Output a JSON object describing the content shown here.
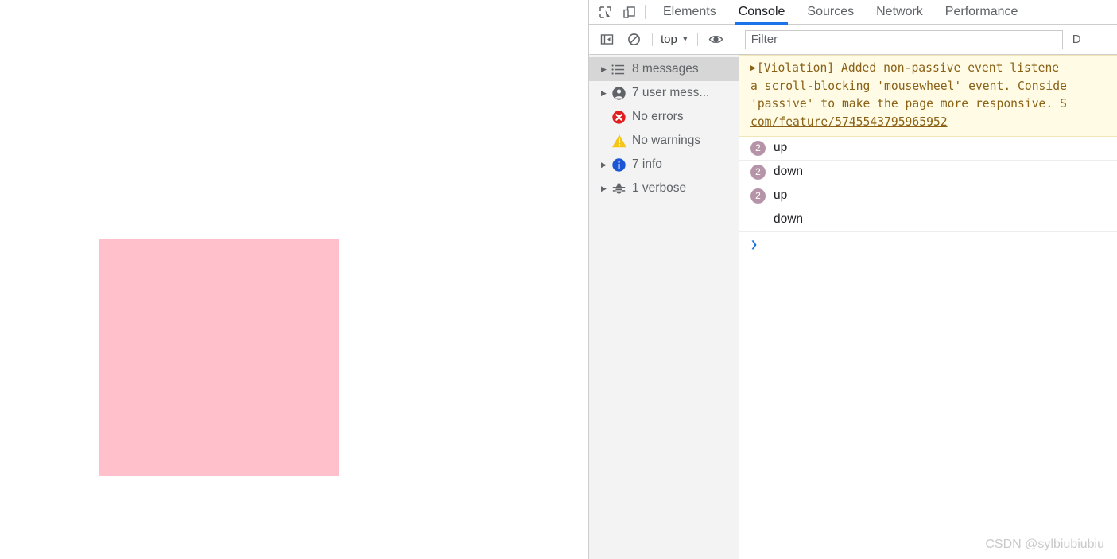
{
  "page": {
    "pink_box": {
      "color": "#ffc0cb"
    }
  },
  "devtools": {
    "toolbar_icons": [
      {
        "name": "inspect-element-icon"
      },
      {
        "name": "device-toolbar-icon"
      }
    ],
    "tabs": [
      {
        "label": "Elements",
        "active": false
      },
      {
        "label": "Console",
        "active": true
      },
      {
        "label": "Sources",
        "active": false
      },
      {
        "label": "Network",
        "active": false
      },
      {
        "label": "Performance",
        "active": false
      }
    ],
    "accent_color": "#1a73e8",
    "filterbar": {
      "sidebar_toggle_icon": "sidebar-toggle-icon",
      "clear_console_icon": "clear-console-icon",
      "context_selector": "top",
      "context_caret": "▼",
      "live_expression_icon": "eye-icon",
      "filter_placeholder": "Filter",
      "filter_value": "",
      "levels_label": "D"
    },
    "sidebar": {
      "rows": [
        {
          "arrow": "▶",
          "icon": "list-icon",
          "label": "8 messages",
          "selected": true
        },
        {
          "arrow": "▶",
          "icon": "user-icon",
          "label": "7 user mess...",
          "selected": false
        },
        {
          "arrow": "",
          "icon": "error-icon",
          "label": "No errors",
          "selected": false
        },
        {
          "arrow": "",
          "icon": "warning-icon",
          "label": "No warnings",
          "selected": false
        },
        {
          "arrow": "▶",
          "icon": "info-icon",
          "label": "7 info",
          "selected": false
        },
        {
          "arrow": "▶",
          "icon": "verbose-bug-icon",
          "label": "1 verbose",
          "selected": false
        }
      ]
    },
    "console": {
      "violation": {
        "expand_arrow": "▶",
        "line1": "[Violation] Added non-passive event listene",
        "line2": "a scroll-blocking 'mousewheel' event. Conside",
        "line3": "'passive' to make the page more responsive. S",
        "link": "com/feature/5745543795965952",
        "bg_color": "#fffbe5",
        "text_color": "#8a6116"
      },
      "messages": [
        {
          "count": "2",
          "text": "up"
        },
        {
          "count": "2",
          "text": "down"
        },
        {
          "count": "2",
          "text": "up"
        },
        {
          "count": "",
          "text": "down"
        }
      ],
      "badge_color": "#b694a8",
      "prompt": "❯"
    }
  },
  "watermark": "CSDN @sylbiubiubiu"
}
